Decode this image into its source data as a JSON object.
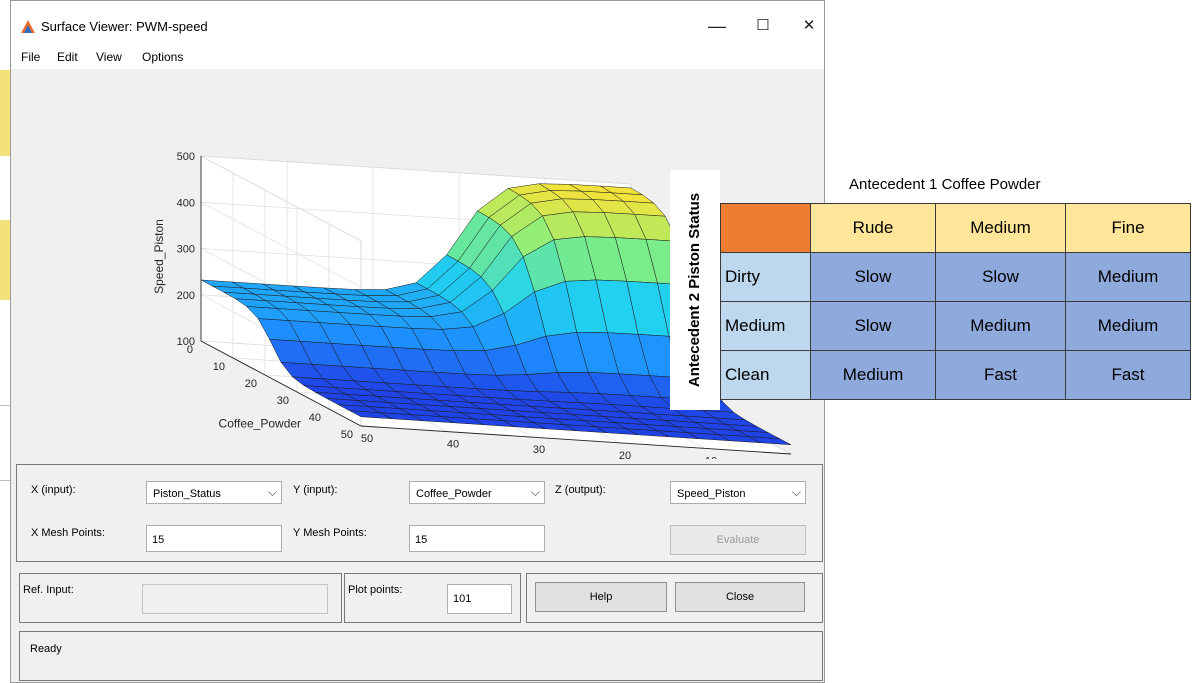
{
  "window": {
    "title": "Surface Viewer: PWM-speed",
    "controls": {
      "minimize": "—",
      "maximize": "☐",
      "close": "✕"
    }
  },
  "menu": [
    "File",
    "Edit",
    "View",
    "Options"
  ],
  "chart_data": {
    "type": "surface3d",
    "xlabel": "Piston_Status",
    "ylabel": "Coffee_Powder",
    "zlabel": "Speed_Piston",
    "x_ticks": [
      0,
      10,
      20,
      30,
      40,
      50
    ],
    "y_ticks": [
      0,
      10,
      20,
      30,
      40,
      50
    ],
    "z_ticks": [
      100,
      200,
      300,
      400,
      500
    ],
    "xlim": [
      0,
      50
    ],
    "ylim": [
      0,
      50
    ],
    "zlim": [
      100,
      500
    ],
    "colormap": [
      "#2030e0",
      "#1e90ff",
      "#22d3ee",
      "#86ef7c",
      "#ffe135"
    ]
  },
  "controls": {
    "x_label": "X (input):",
    "x_value": "Piston_Status",
    "y_label": "Y (input):",
    "y_value": "Coffee_Powder",
    "z_label": "Z (output):",
    "z_value": "Speed_Piston",
    "xmesh_label": "X Mesh Points:",
    "xmesh_value": "15",
    "ymesh_label": "Y Mesh Points:",
    "ymesh_value": "15",
    "evaluate": "Evaluate",
    "ref_label": "Ref. Input:",
    "plot_points_label": "Plot points:",
    "plot_points_value": "101",
    "help": "Help",
    "close": "Close",
    "status": "Ready"
  },
  "rule_table": {
    "title": "Antecedent 1 Coffee Powder",
    "row_title": "Antecedent 2 Piston Status",
    "columns": [
      "Rude",
      "Medium",
      "Fine"
    ],
    "rows": [
      {
        "label": "Dirty",
        "cells": [
          "Slow",
          "Slow",
          "Medium"
        ]
      },
      {
        "label": "Medium",
        "cells": [
          "Slow",
          "Medium",
          "Medium"
        ]
      },
      {
        "label": "Clean",
        "cells": [
          "Medium",
          "Fast",
          "Fast"
        ]
      }
    ],
    "colors": {
      "corner": "#ed7d31",
      "header": "#ffe699",
      "rowhead": "#bdd7ee",
      "cell": "#8ea9db"
    }
  }
}
